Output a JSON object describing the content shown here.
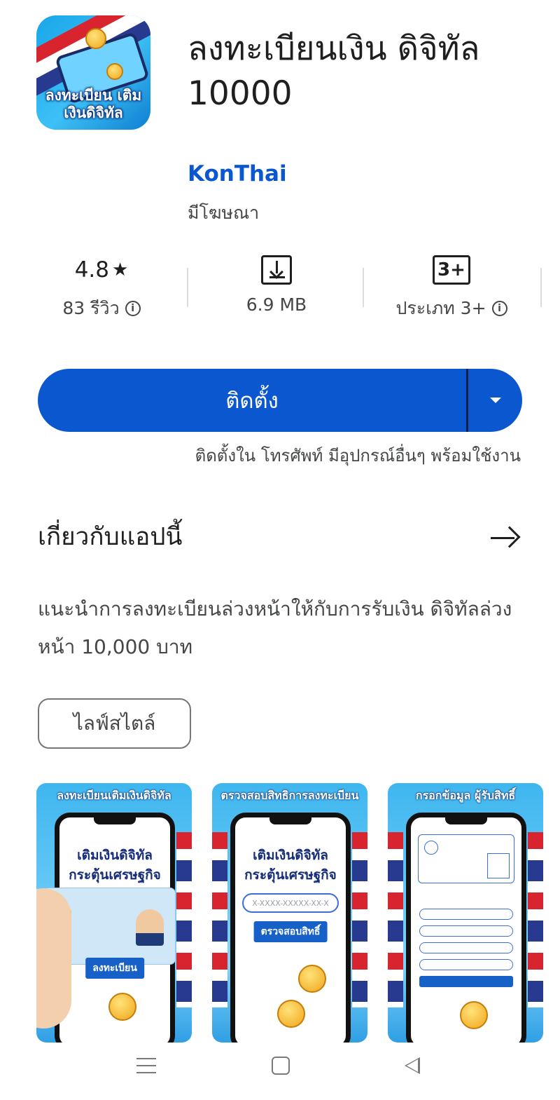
{
  "app": {
    "title": "ลงทะเบียนเงิน ดิจิทัล 10000",
    "developer": "KonThai",
    "ads_note": "มีโฆษณา",
    "icon_text": "ลงทะเบียน เติมเงินดิจิทัล"
  },
  "stats": {
    "rating": "4.8",
    "rating_star": "★",
    "reviews": "83 รีวิว",
    "size": "6.9 MB",
    "age_badge": "3+",
    "age_label": "ประเภท 3+"
  },
  "install": {
    "label": "ติดตั้ง",
    "note": "ติดตั้งใน โทรศัพท์ มีอุปกรณ์อื่นๆ พร้อมใช้งาน"
  },
  "about": {
    "title": "เกี่ยวกับแอปนี้",
    "description": "แนะนำการลงทะเบียนล่วงหน้าให้กับการรับเงิน ดิจิทัลล่วงหน้า 10,000 บาท",
    "category_chip": "ไลฟ์สไตล์"
  },
  "screenshots": [
    {
      "caption": "ลงทะเบียนเติมเงินดิจิทัล",
      "heading": "เติมเงินดิจิทัล กระตุ้นเศรษฐกิจ",
      "button": "ลงทะเบียน"
    },
    {
      "caption": "ตรวจสอบสิทธิการลงทะเบียน",
      "heading": "เติมเงินดิจิทัล กระตุ้นเศรษฐกิจ",
      "input_placeholder": "X-XXXX-XXXXX-XX-X",
      "button": "ตรวจสอบสิทธิ์"
    },
    {
      "caption": "กรอกข้อมูล ผู้รับสิทธิ์"
    }
  ],
  "colors": {
    "accent": "#0b57d0",
    "text_primary": "#1f1f1f",
    "text_secondary": "#444746"
  },
  "icons": {
    "info": "info-icon",
    "download": "download-icon",
    "arrow": "arrow-right-icon",
    "dropdown": "caret-down-icon"
  }
}
